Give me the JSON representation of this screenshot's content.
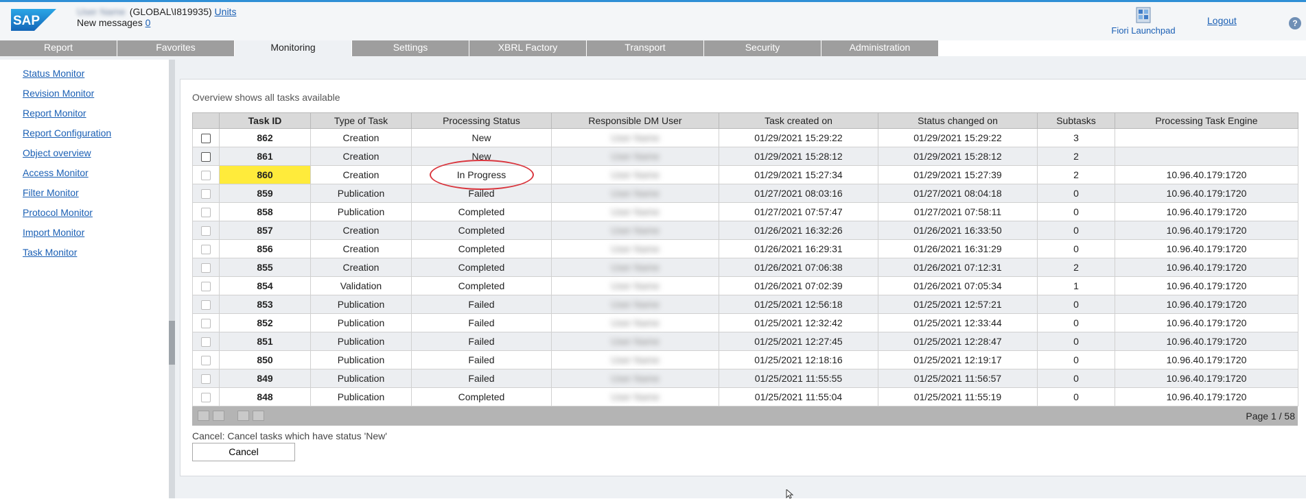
{
  "header": {
    "logo_text": "SAP",
    "user_name": "User Name",
    "user_id": "(GLOBAL\\I819935)",
    "units_link": "Units",
    "messages_label": "New messages",
    "messages_count": "0",
    "fiori_label": "Fiori Launchpad",
    "logout_label": "Logout",
    "help_symbol": "?"
  },
  "tabs": [
    "Report",
    "Favorites",
    "Monitoring",
    "Settings",
    "XBRL Factory",
    "Transport",
    "Security",
    "Administration"
  ],
  "active_tab": "Monitoring",
  "sidebar": {
    "items": [
      "Status Monitor",
      "Revision Monitor",
      "Report Monitor",
      "Report Configuration",
      "Object overview",
      "Access Monitor",
      "Filter Monitor",
      "Protocol Monitor",
      "Import Monitor",
      "Task Monitor"
    ]
  },
  "main": {
    "overview_text": "Overview shows all tasks available",
    "columns": [
      "",
      "Task ID",
      "Type of Task",
      "Processing Status",
      "Responsible DM User",
      "Task created on",
      "Status changed on",
      "Subtasks",
      "Processing Task Engine"
    ],
    "rows": [
      {
        "id": "862",
        "type": "Creation",
        "status": "New",
        "user": "User Name",
        "created": "01/29/2021 15:29:22",
        "changed": "01/29/2021 15:29:22",
        "subtasks": "3",
        "engine": "",
        "checkbox": "enabled"
      },
      {
        "id": "861",
        "type": "Creation",
        "status": "New",
        "user": "User Name",
        "created": "01/29/2021 15:28:12",
        "changed": "01/29/2021 15:28:12",
        "subtasks": "2",
        "engine": "",
        "checkbox": "enabled"
      },
      {
        "id": "860",
        "type": "Creation",
        "status": "In Progress",
        "user": "User Name",
        "created": "01/29/2021 15:27:34",
        "changed": "01/29/2021 15:27:39",
        "subtasks": "2",
        "engine": "10.96.40.179:1720",
        "checkbox": "disabled",
        "highlight": true
      },
      {
        "id": "859",
        "type": "Publication",
        "status": "Failed",
        "user": "User Name",
        "created": "01/27/2021 08:03:16",
        "changed": "01/27/2021 08:04:18",
        "subtasks": "0",
        "engine": "10.96.40.179:1720",
        "checkbox": "disabled"
      },
      {
        "id": "858",
        "type": "Publication",
        "status": "Completed",
        "user": "User Name",
        "created": "01/27/2021 07:57:47",
        "changed": "01/27/2021 07:58:11",
        "subtasks": "0",
        "engine": "10.96.40.179:1720",
        "checkbox": "disabled"
      },
      {
        "id": "857",
        "type": "Creation",
        "status": "Completed",
        "user": "User Name",
        "created": "01/26/2021 16:32:26",
        "changed": "01/26/2021 16:33:50",
        "subtasks": "0",
        "engine": "10.96.40.179:1720",
        "checkbox": "disabled"
      },
      {
        "id": "856",
        "type": "Creation",
        "status": "Completed",
        "user": "User Name",
        "created": "01/26/2021 16:29:31",
        "changed": "01/26/2021 16:31:29",
        "subtasks": "0",
        "engine": "10.96.40.179:1720",
        "checkbox": "disabled"
      },
      {
        "id": "855",
        "type": "Creation",
        "status": "Completed",
        "user": "User Name",
        "created": "01/26/2021 07:06:38",
        "changed": "01/26/2021 07:12:31",
        "subtasks": "2",
        "engine": "10.96.40.179:1720",
        "checkbox": "disabled"
      },
      {
        "id": "854",
        "type": "Validation",
        "status": "Completed",
        "user": "User Name",
        "created": "01/26/2021 07:02:39",
        "changed": "01/26/2021 07:05:34",
        "subtasks": "1",
        "engine": "10.96.40.179:1720",
        "checkbox": "disabled"
      },
      {
        "id": "853",
        "type": "Publication",
        "status": "Failed",
        "user": "User Name",
        "created": "01/25/2021 12:56:18",
        "changed": "01/25/2021 12:57:21",
        "subtasks": "0",
        "engine": "10.96.40.179:1720",
        "checkbox": "disabled"
      },
      {
        "id": "852",
        "type": "Publication",
        "status": "Failed",
        "user": "User Name",
        "created": "01/25/2021 12:32:42",
        "changed": "01/25/2021 12:33:44",
        "subtasks": "0",
        "engine": "10.96.40.179:1720",
        "checkbox": "disabled"
      },
      {
        "id": "851",
        "type": "Publication",
        "status": "Failed",
        "user": "User Name",
        "created": "01/25/2021 12:27:45",
        "changed": "01/25/2021 12:28:47",
        "subtasks": "0",
        "engine": "10.96.40.179:1720",
        "checkbox": "disabled"
      },
      {
        "id": "850",
        "type": "Publication",
        "status": "Failed",
        "user": "User Name",
        "created": "01/25/2021 12:18:16",
        "changed": "01/25/2021 12:19:17",
        "subtasks": "0",
        "engine": "10.96.40.179:1720",
        "checkbox": "disabled"
      },
      {
        "id": "849",
        "type": "Publication",
        "status": "Failed",
        "user": "User Name",
        "created": "01/25/2021 11:55:55",
        "changed": "01/25/2021 11:56:57",
        "subtasks": "0",
        "engine": "10.96.40.179:1720",
        "checkbox": "disabled"
      },
      {
        "id": "848",
        "type": "Publication",
        "status": "Completed",
        "user": "User Name",
        "created": "01/25/2021 11:55:04",
        "changed": "01/25/2021 11:55:19",
        "subtasks": "0",
        "engine": "10.96.40.179:1720",
        "checkbox": "disabled"
      }
    ],
    "pager_text": "Page 1 / 58",
    "cancel_hint": "Cancel: Cancel tasks which have status 'New'",
    "cancel_button": "Cancel"
  },
  "colors": {
    "accent_blue": "#2f8fd6",
    "link_blue": "#1a5fb4",
    "tab_gray": "#9e9e9e",
    "highlight_yellow": "#ffeb3b",
    "annotation_red": "#d9353d"
  },
  "icons": [
    "sap-logo",
    "fiori-launchpad-icon",
    "help-icon",
    "first-page-icon",
    "previous-page-icon",
    "next-page-icon",
    "last-page-icon",
    "mouse-cursor-icon"
  ]
}
